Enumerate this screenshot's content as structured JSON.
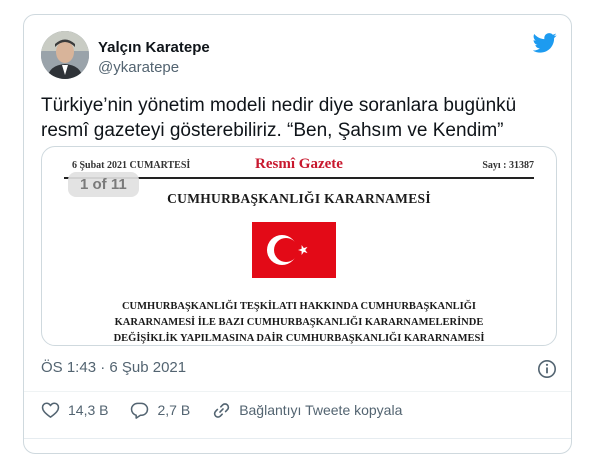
{
  "colors": {
    "twitter_blue": "#1d9bf0",
    "text_primary": "#0f1419",
    "text_secondary": "#536471",
    "gazette_red": "#c8182e",
    "flag_red": "#e30a17"
  },
  "tweet": {
    "author": {
      "name": "Yalçın Karatepe",
      "handle": "@ykaratepe",
      "avatar_icon": "avatar-photo"
    },
    "brand_icon": "twitter-bird-icon",
    "text": "Türkiye’nin yönetim modeli nedir diye soranlara bugünkü resmî gazeteyi gösterebiliriz. “Ben, Şahsım ve Kendim”",
    "media": {
      "counter": "1 of 11",
      "gazette": {
        "date": "6 Şubat 2021 CUMARTESİ",
        "title": "Resmî Gazete",
        "issue": "Sayı : 31387",
        "heading": "CUMHURBAŞKANLIĞI KARARNAMESİ",
        "body_lines": [
          "CUMHURBAŞKANLIĞI TEŞKİLATI HAKKINDA CUMHURBAŞKANLIĞI",
          "KARARNAMESİ İLE BAZI CUMHURBAŞKANLIĞI KARARNAMELERİNDE",
          "DEĞİŞİKLİK YAPILMASINA DAİR CUMHURBAŞKANLIĞI KARARNAMESİ"
        ]
      }
    },
    "timestamp": "ÖS 1:43 · 6 Şub 2021",
    "actions": {
      "likes": "14,3 B",
      "replies": "2,7 B",
      "copy_link": "Bağlantıyı Tweete kopyala"
    }
  }
}
